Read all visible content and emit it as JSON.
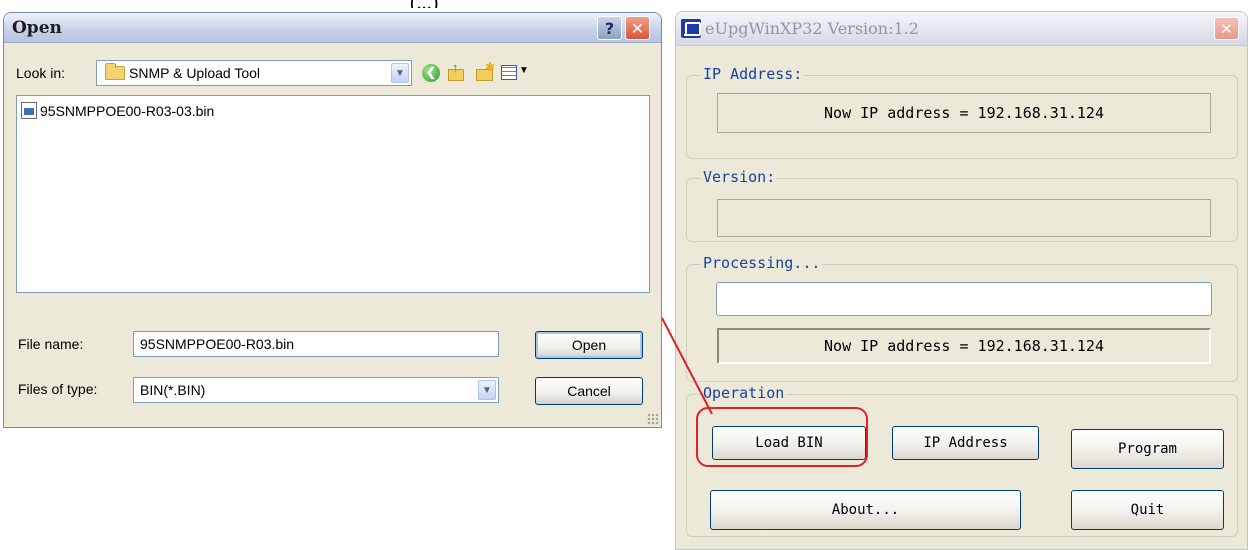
{
  "caption_fragment": "(...)",
  "open_dialog": {
    "title": "Open",
    "help_glyph": "?",
    "close_glyph": "✕",
    "look_in_label": "Look in:",
    "look_in_value": "SNMP & Upload Tool",
    "files": [
      {
        "name": "95SNMPPOE00-R03-03.bin"
      }
    ],
    "file_name_label": "File name:",
    "file_name_value": "95SNMPPOE00-R03.bin",
    "files_of_type_label": "Files of type:",
    "files_of_type_value": "BIN(*.BIN)",
    "open_button": "Open",
    "cancel_button": "Cancel"
  },
  "eupg_window": {
    "title": "eUpgWinXP32 Version:1.2",
    "close_glyph": "✕",
    "ip_group": {
      "label": "IP Address:",
      "value": "Now IP address = 192.168.31.124"
    },
    "version_group": {
      "label": "Version:",
      "value": ""
    },
    "processing_group": {
      "label": "Processing...",
      "progress": 0,
      "status": "Now IP address = 192.168.31.124"
    },
    "operation_group": {
      "label": "Operation",
      "buttons": {
        "load_bin": "Load BIN",
        "ip_address": "IP Address",
        "program": "Program",
        "about": "About...",
        "quit": "Quit"
      }
    }
  },
  "colors": {
    "annotation": "#e0202a",
    "group_label": "#1a3fa8",
    "dialog_bg": "#ece9d8"
  }
}
